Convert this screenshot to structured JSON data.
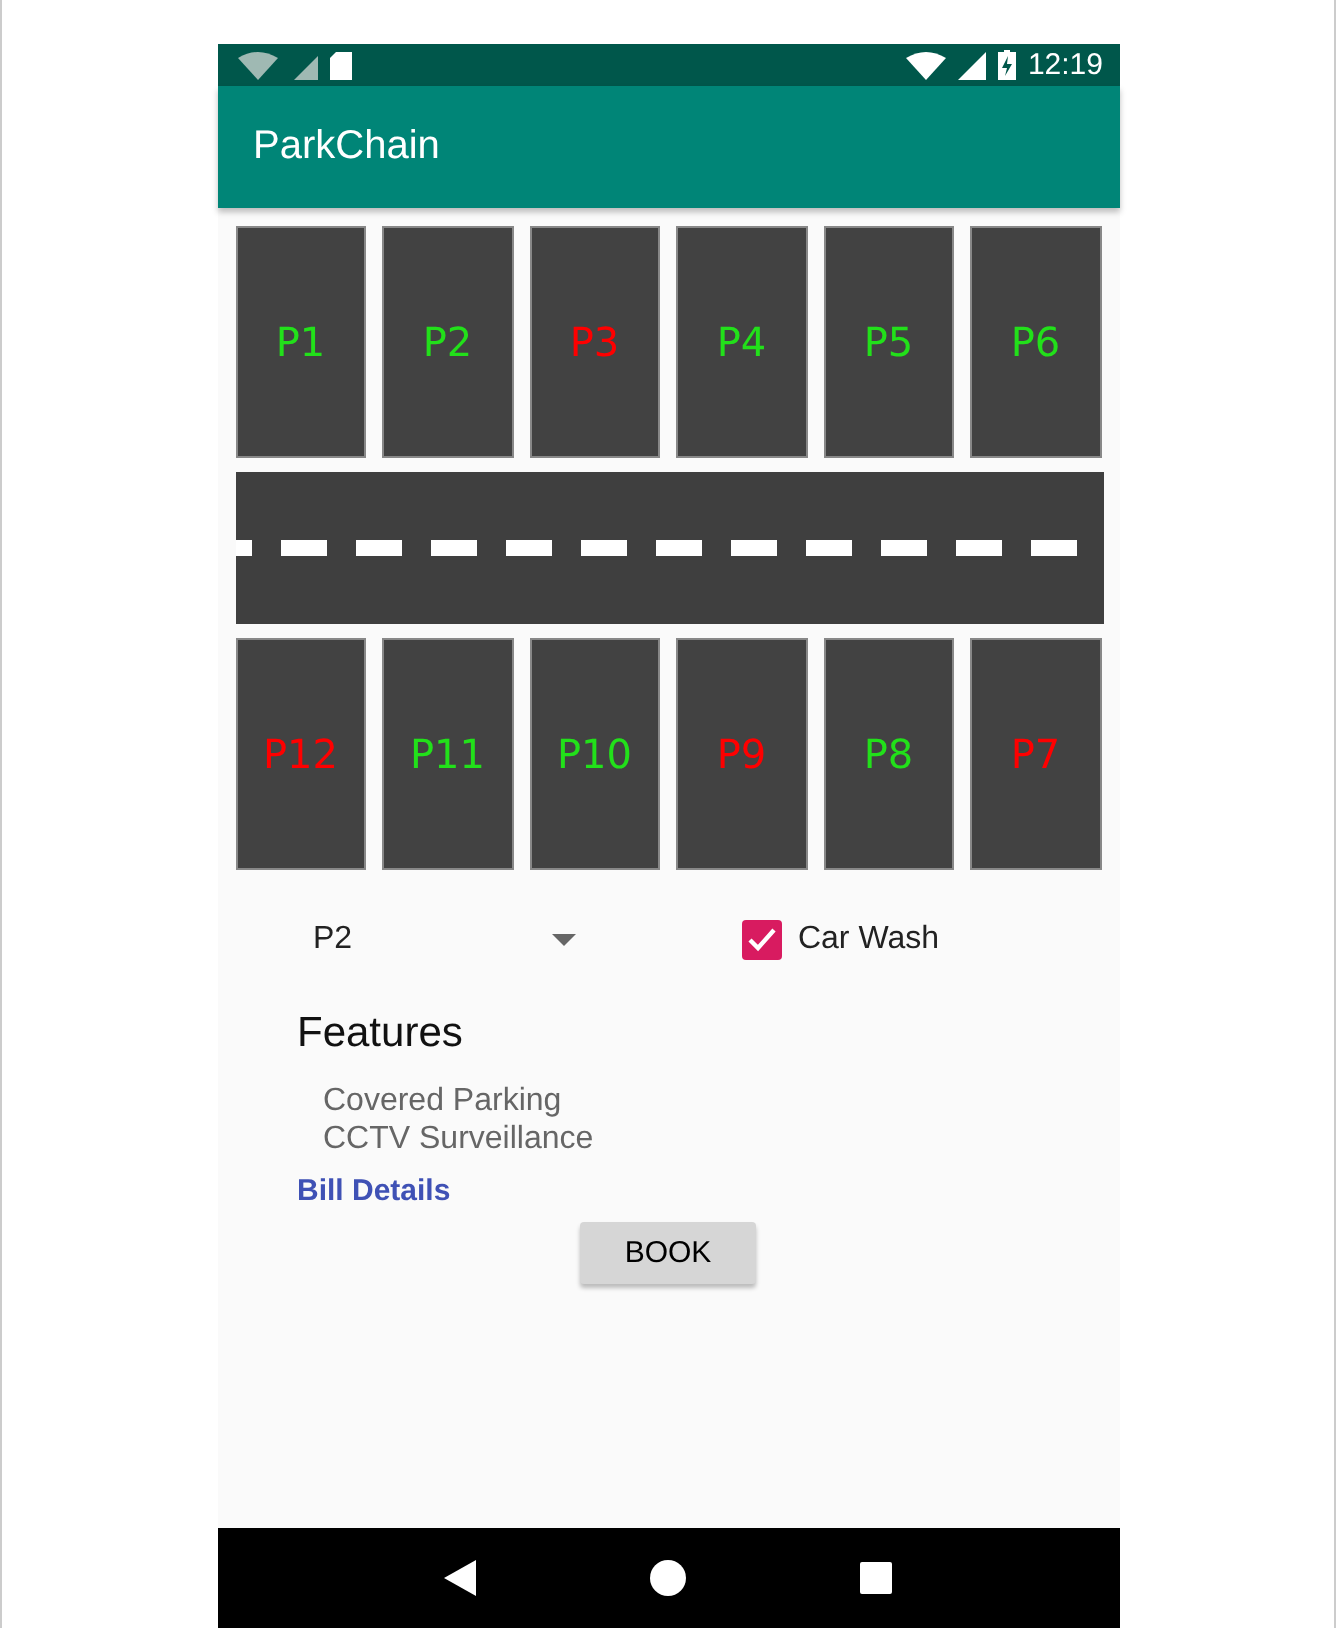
{
  "status_bar": {
    "time": "12:19"
  },
  "app_bar": {
    "title": "ParkChain"
  },
  "spots_top": [
    {
      "label": "P1",
      "occupied": false
    },
    {
      "label": "P2",
      "occupied": false
    },
    {
      "label": "P3",
      "occupied": true
    },
    {
      "label": "P4",
      "occupied": false
    },
    {
      "label": "P5",
      "occupied": false
    },
    {
      "label": "P6",
      "occupied": false
    }
  ],
  "spots_bottom": [
    {
      "label": "P12",
      "occupied": true
    },
    {
      "label": "P11",
      "occupied": false
    },
    {
      "label": "P10",
      "occupied": false
    },
    {
      "label": "P9",
      "occupied": true
    },
    {
      "label": "P8",
      "occupied": false
    },
    {
      "label": "P7",
      "occupied": true
    }
  ],
  "spot_selector": {
    "value": "P2"
  },
  "car_wash": {
    "label": "Car Wash",
    "checked": true
  },
  "features": {
    "title": "Features",
    "items": [
      "Covered Parking",
      "CCTV Surveillance"
    ]
  },
  "bill_link": "Bill Details",
  "book_button": "BOOK"
}
